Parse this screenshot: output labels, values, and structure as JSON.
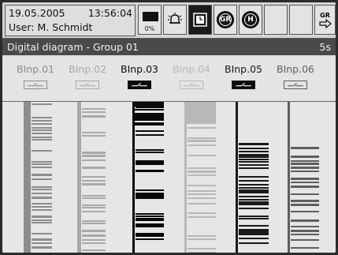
{
  "status": {
    "date": "19.05.2005",
    "time": "13:56:04",
    "user": "User: M. Schmidt"
  },
  "memory": {
    "percent_label": "0%"
  },
  "toolbar": {
    "alarm_icon": "bell-alarm-icon",
    "diagram_icon": "clock-diagram-icon",
    "group_button": "GR",
    "history_button": "H",
    "next_group_label": "GR"
  },
  "diagram": {
    "title": "Digital diagram - Group 01",
    "interval": "5s",
    "channels": [
      {
        "label": "BInp.01",
        "active": false,
        "color": "#8d8d8d"
      },
      {
        "label": "BInp.02",
        "active": false,
        "color": "#a9a9a9"
      },
      {
        "label": "BInp.03",
        "active": true,
        "color": "#0a0a0a"
      },
      {
        "label": "BInp.04",
        "active": false,
        "color": "#b8b8b8"
      },
      {
        "label": "BInp.05",
        "active": true,
        "color": "#1a1a1a"
      },
      {
        "label": "BInp.06",
        "active": false,
        "color": "#5e5e5e"
      }
    ]
  },
  "colors": {
    "titlebar": "#4a4a4a",
    "background": "#e9e9e9"
  }
}
